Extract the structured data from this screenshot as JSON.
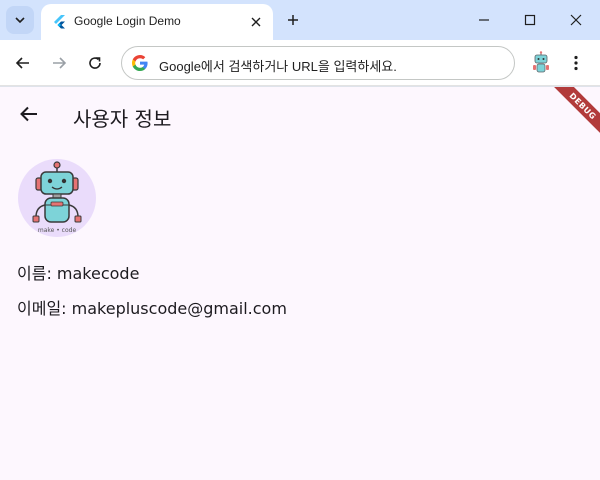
{
  "browser": {
    "tab": {
      "title": "Google Login Demo",
      "favicon": "flutter-icon"
    },
    "omnibox": {
      "placeholder": "Google에서 검색하거나 URL을 입력하세요."
    },
    "icons": [
      "tab-search-icon",
      "close-icon",
      "plus-icon",
      "minimize-icon",
      "maximize-icon",
      "window-close-icon",
      "back-arrow-icon",
      "forward-arrow-icon",
      "reload-icon",
      "google-icon",
      "extension-robot-icon",
      "more-vert-icon"
    ]
  },
  "app": {
    "title": "사용자 정보",
    "debug_banner": "DEBUG",
    "avatar_caption": "make • code",
    "name_line": "이름: makecode",
    "email_line": "이메일: makepluscode@gmail.com"
  },
  "colors": {
    "tabstrip": "#d3e3fd",
    "app_background": "#fdf7fe",
    "avatar_background": "#eadcfb",
    "debug_banner": "#b23b3b",
    "robot_body": "#7dd3d8"
  }
}
